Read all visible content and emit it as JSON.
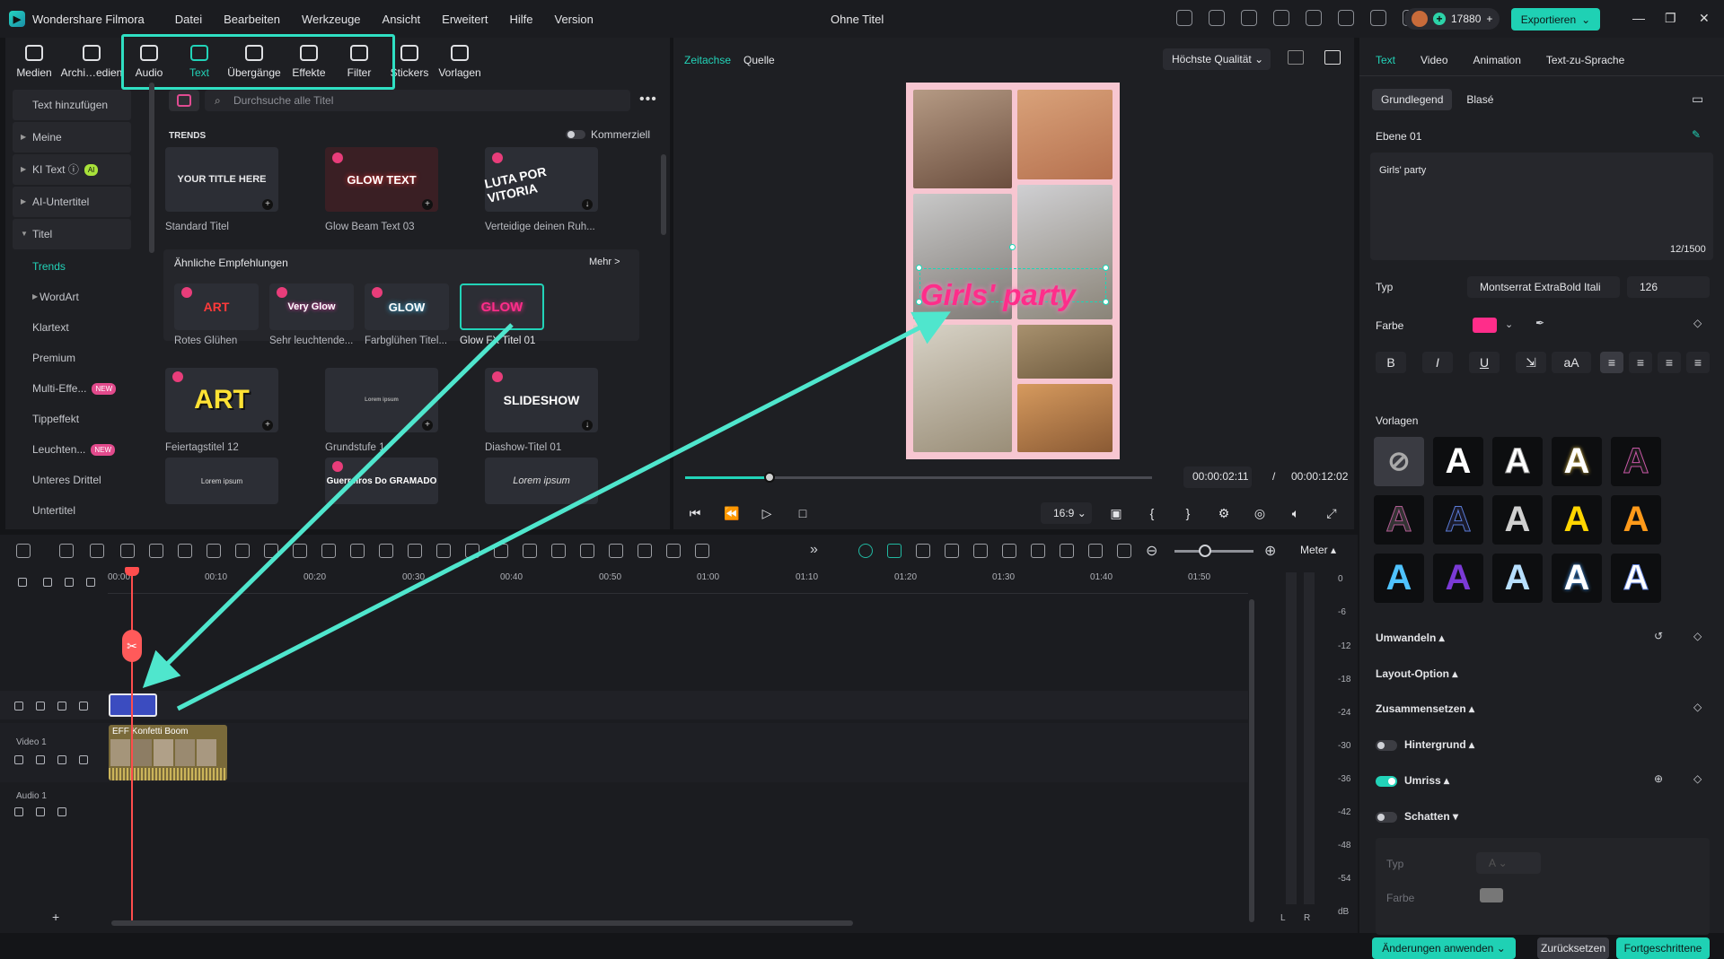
{
  "app": {
    "name": "Wondershare Filmora",
    "window_title": "Ohne Titel",
    "credits": "17880",
    "export_label": "Exportieren",
    "accent": "#22d3b8"
  },
  "menu": [
    "Datei",
    "Bearbeiten",
    "Werkzeuge",
    "Ansicht",
    "Erweitert",
    "Hilfe",
    "Version"
  ],
  "media_tabs": [
    {
      "label": "Medien",
      "icon": "media-icon"
    },
    {
      "label": "Archi…edien",
      "icon": "archive-icon"
    },
    {
      "label": "Audio",
      "icon": "music-note-icon"
    },
    {
      "label": "Text",
      "icon": "text-icon"
    },
    {
      "label": "Übergänge",
      "icon": "transition-icon"
    },
    {
      "label": "Effekte",
      "icon": "sparkle-icon"
    },
    {
      "label": "Filter",
      "icon": "filter-icon"
    },
    {
      "label": "Stickers",
      "icon": "sticker-icon"
    },
    {
      "label": "Vorlagen",
      "icon": "template-icon"
    }
  ],
  "categories": {
    "add_text": "Text hinzufügen",
    "items": [
      "Meine",
      "KI Text",
      "AI-Untertitel",
      "Titel"
    ],
    "ai_badge": "AI",
    "sub": [
      "Trends",
      "WordArt",
      "Klartext",
      "Premium",
      "Multi-Effe...",
      "Tippeffekt",
      "Leuchten...",
      "Unteres Drittel",
      "Untertitel"
    ],
    "new_badge": "NEW"
  },
  "search": {
    "placeholder": "Durchsuche alle Titel"
  },
  "trends": {
    "heading": "TRENDS",
    "commercial_label": "Kommerziell",
    "cards": [
      {
        "thumb": "YOUR TITLE HERE",
        "caption": "Standard Titel"
      },
      {
        "thumb": "GLOW TEXT",
        "caption": "Glow Beam Text 03"
      },
      {
        "thumb": "LUTA POR VITORIA",
        "caption": "Verteidige deinen Ruh..."
      }
    ],
    "similar_heading": "Ähnliche Empfehlungen",
    "more": "Mehr >",
    "similar": [
      {
        "thumb": "ART",
        "caption": "Rotes Glühen"
      },
      {
        "thumb": "Very Glow",
        "caption": "Sehr leuchtende..."
      },
      {
        "thumb": "GLOW",
        "caption": "Farbglühen Titel..."
      },
      {
        "thumb": "GLOW",
        "caption": "Glow FX Titel 01"
      }
    ],
    "row3": [
      {
        "thumb": "ART",
        "caption": "Feiertagstitel 12"
      },
      {
        "thumb": "Lorem ipsum",
        "caption": "Grundstufe 1"
      },
      {
        "thumb": "SLIDESHOW",
        "caption": "Diashow-Titel 01"
      }
    ],
    "row4": [
      {
        "thumb": "Lorem ipsum"
      },
      {
        "thumb": "Guerreiros Do GRAMADO"
      },
      {
        "thumb": "Lorem ipsum"
      }
    ]
  },
  "preview": {
    "tabs": [
      "Zeitachse",
      "Quelle"
    ],
    "quality": "Höchste Qualität",
    "overlay_text": "Girls' party",
    "current_time": "00:00:02:11",
    "separator": "/",
    "total_time": "00:00:12:02",
    "ratio": "16:9",
    "progress": 0.18
  },
  "right": {
    "tabs": [
      "Text",
      "Video",
      "Animation",
      "Text-zu-Sprache"
    ],
    "modes": [
      "Grundlegend",
      "Blasé"
    ],
    "layer": "Ebene 01",
    "text_value": "Girls' party",
    "char_count": "12/1500",
    "type_label": "Typ",
    "font": "Montserrat ExtraBold Itali",
    "size": "126",
    "color_label": "Farbe",
    "color": "#ff2d8a",
    "format": [
      "B",
      "I",
      "U"
    ],
    "templates_label": "Vorlagen",
    "sections": {
      "transform": "Umwandeln",
      "layout": "Layout-Option",
      "compose": "Zusammensetzen",
      "background": "Hintergrund",
      "outline": "Umriss",
      "shadow": "Schatten"
    },
    "shadow_type": "Typ",
    "shadow_color": "Farbe",
    "apply": "Änderungen anwenden",
    "reset": "Zurücksetzen",
    "advanced": "Fortgeschrittene"
  },
  "timeline": {
    "ruler": [
      "00:00",
      "00:10",
      "00:20",
      "00:30",
      "00:40",
      "00:50",
      "01:00",
      "01:10",
      "01:20",
      "01:30",
      "01:40",
      "01:50"
    ],
    "tracks": [
      "Video 1",
      "Audio 1"
    ],
    "clip_title": "EFF Konfetti Boom",
    "meter_label": "Meter",
    "db_values": [
      "0",
      "-6",
      "-12",
      "-18",
      "-24",
      "-30",
      "-36",
      "-42",
      "-48",
      "-54",
      "dB"
    ],
    "lr": [
      "L",
      "R"
    ]
  }
}
